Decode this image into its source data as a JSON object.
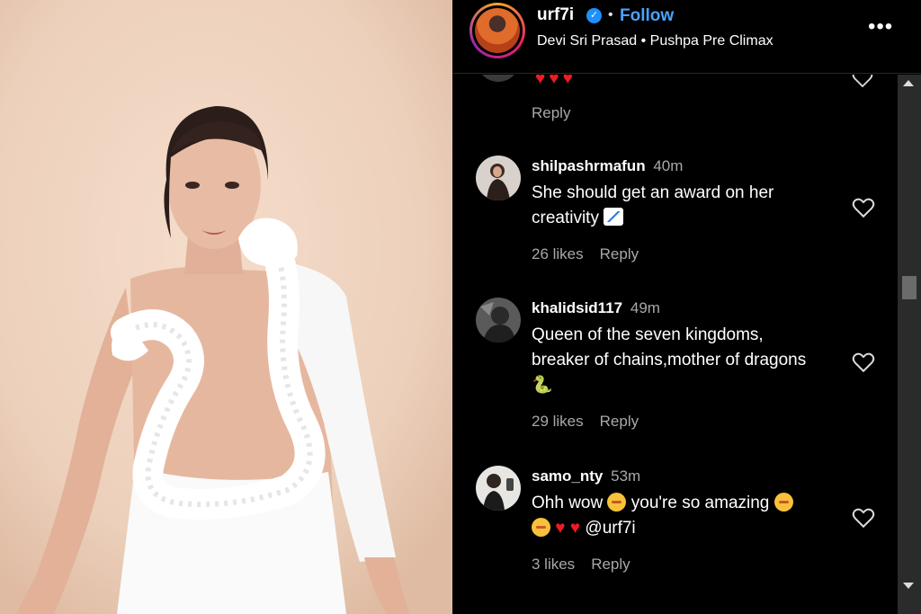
{
  "post": {
    "username": "urf7i",
    "separator": "•",
    "follow_label": "Follow",
    "audio": "Devi Sri Prasad • Pushpa Pre Climax",
    "more_label": "•••"
  },
  "previous_comment": {
    "text": "♥♥♥",
    "reply_label": "Reply"
  },
  "comments": [
    {
      "username": "shilpashrmafun",
      "time": "40m",
      "text": "She should get an award on her creativity",
      "likes": "26 likes",
      "reply_label": "Reply"
    },
    {
      "username": "khalidsid117",
      "time": "49m",
      "text": "Queen of the seven kingdoms, breaker of chains,mother of dragons",
      "emoji": "🐍",
      "likes": "29 likes",
      "reply_label": "Reply"
    },
    {
      "username": "samo_nty",
      "time": "53m",
      "text_a": "Ohh wow",
      "text_b": "you're so amazing",
      "hearts": "♥ ♥",
      "mention": "@urf7i",
      "likes": "3 likes",
      "reply_label": "Reply"
    }
  ],
  "icons": {
    "verified": "verified-badge-icon",
    "like": "heart-outline-icon",
    "more": "more-options-icon"
  },
  "colors": {
    "follow": "#4aa3ff",
    "verified": "#1e90ff",
    "heart": "#ed1c24",
    "secondary_text": "#a8a8a8"
  }
}
